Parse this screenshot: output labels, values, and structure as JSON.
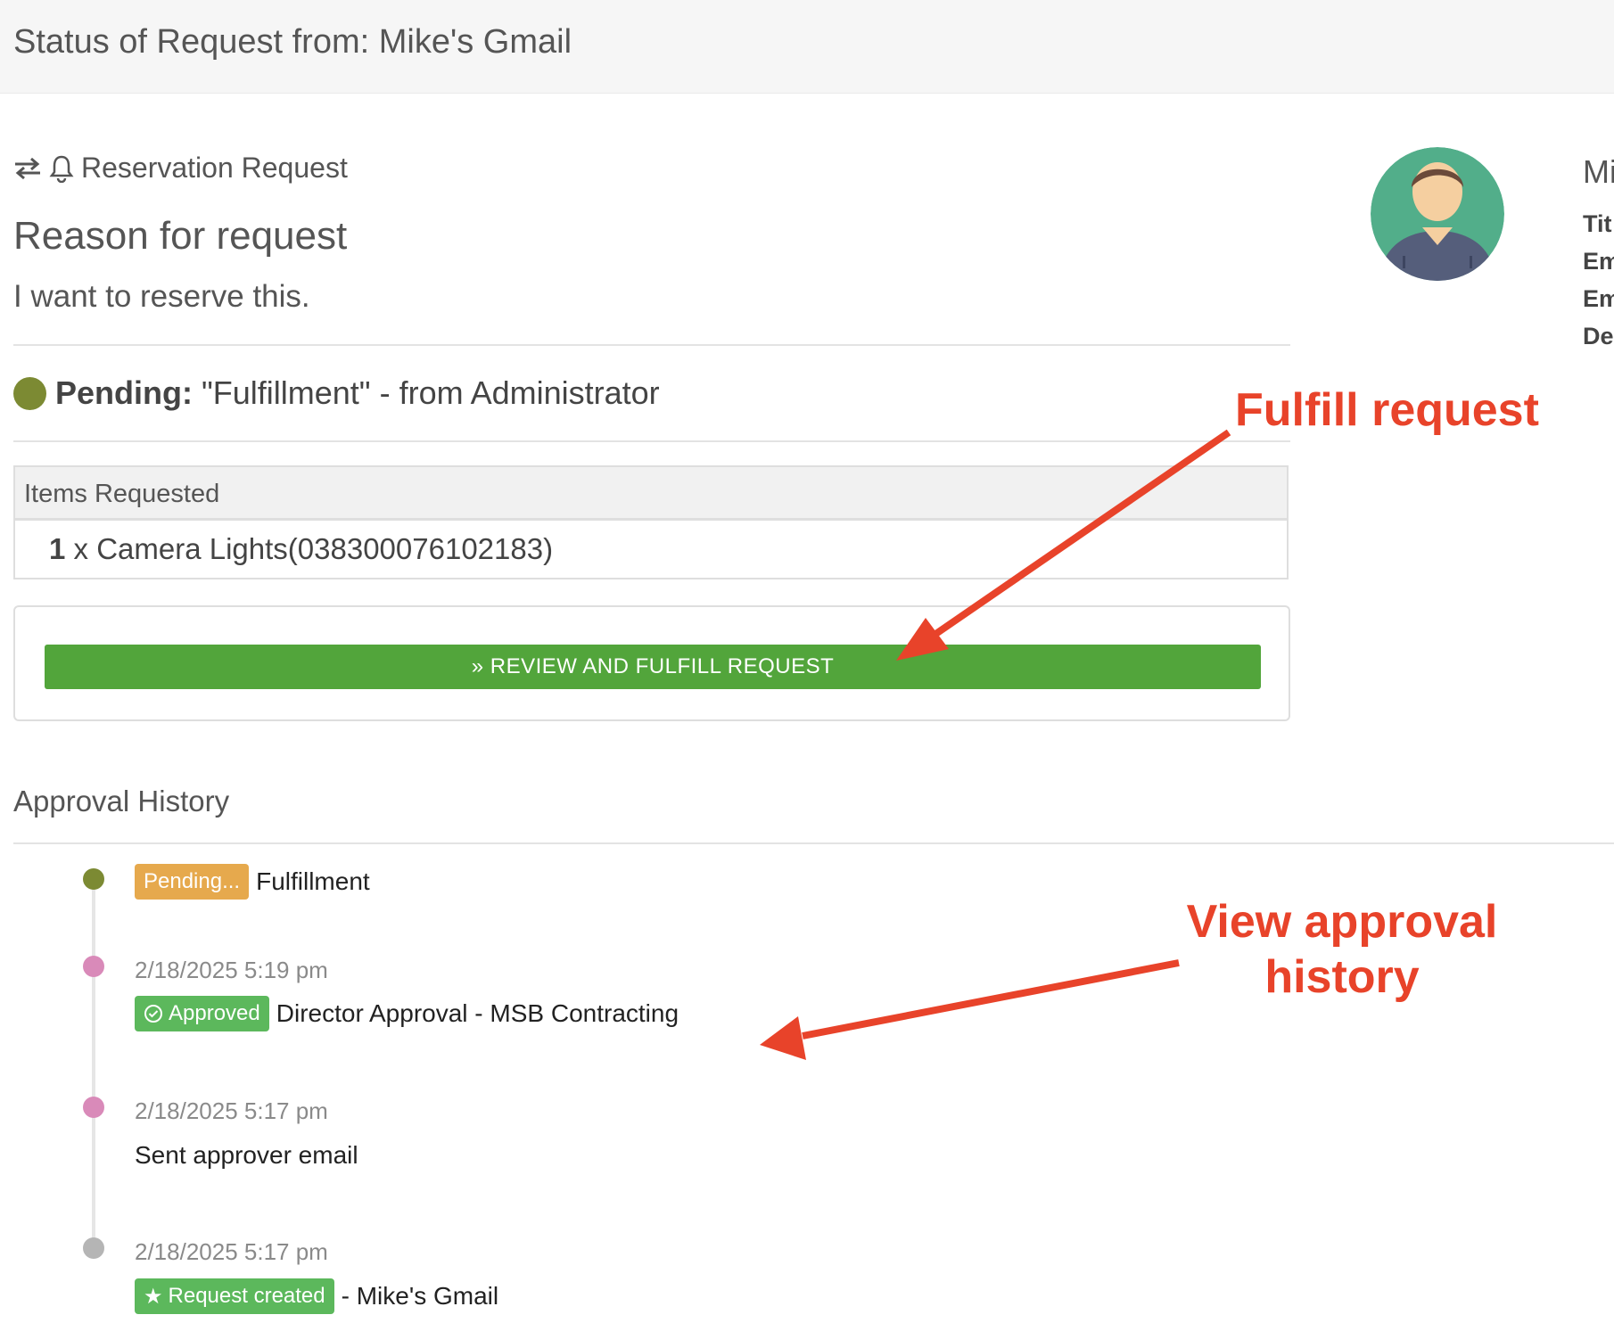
{
  "header": {
    "title": "Status of Request from: Mike's Gmail"
  },
  "request": {
    "type_label": "Reservation Request",
    "reason_title": "Reason for request",
    "reason_text": "I want to reserve this.",
    "status_label": "Pending:",
    "status_detail": "\"Fulfillment\" - from Administrator",
    "status_color": "#7c8a33"
  },
  "items": {
    "header": "Items Requested",
    "rows": [
      {
        "qty": "1",
        "sep": "x",
        "name": "Camera Lights(038300076102183)"
      }
    ]
  },
  "action": {
    "button_label": "REVIEW AND FULFILL REQUEST"
  },
  "profile": {
    "name": "Mi",
    "fields": [
      "Tit",
      "Em",
      "Em",
      "De"
    ]
  },
  "approval_history": {
    "title": "Approval History",
    "entries": [
      {
        "date": "",
        "badge": "Pending...",
        "text": "Fulfillment",
        "dot_color": "#7c8a33"
      },
      {
        "date": "2/18/2025 5:19 pm",
        "badge": "Approved",
        "text": "Director Approval - MSB Contracting",
        "dot_color": "#d98ab9"
      },
      {
        "date": "2/18/2025 5:17 pm",
        "badge": "",
        "text": "Sent approver email",
        "dot_color": "#d98ab9"
      },
      {
        "date": "2/18/2025 5:17 pm",
        "badge": "Request created",
        "text": "- Mike's Gmail",
        "dot_color": "#b5b5b5"
      }
    ]
  },
  "annotations": {
    "fulfill": "Fulfill request",
    "history_line1": "View approval",
    "history_line2": "history",
    "color": "#e8432a"
  }
}
